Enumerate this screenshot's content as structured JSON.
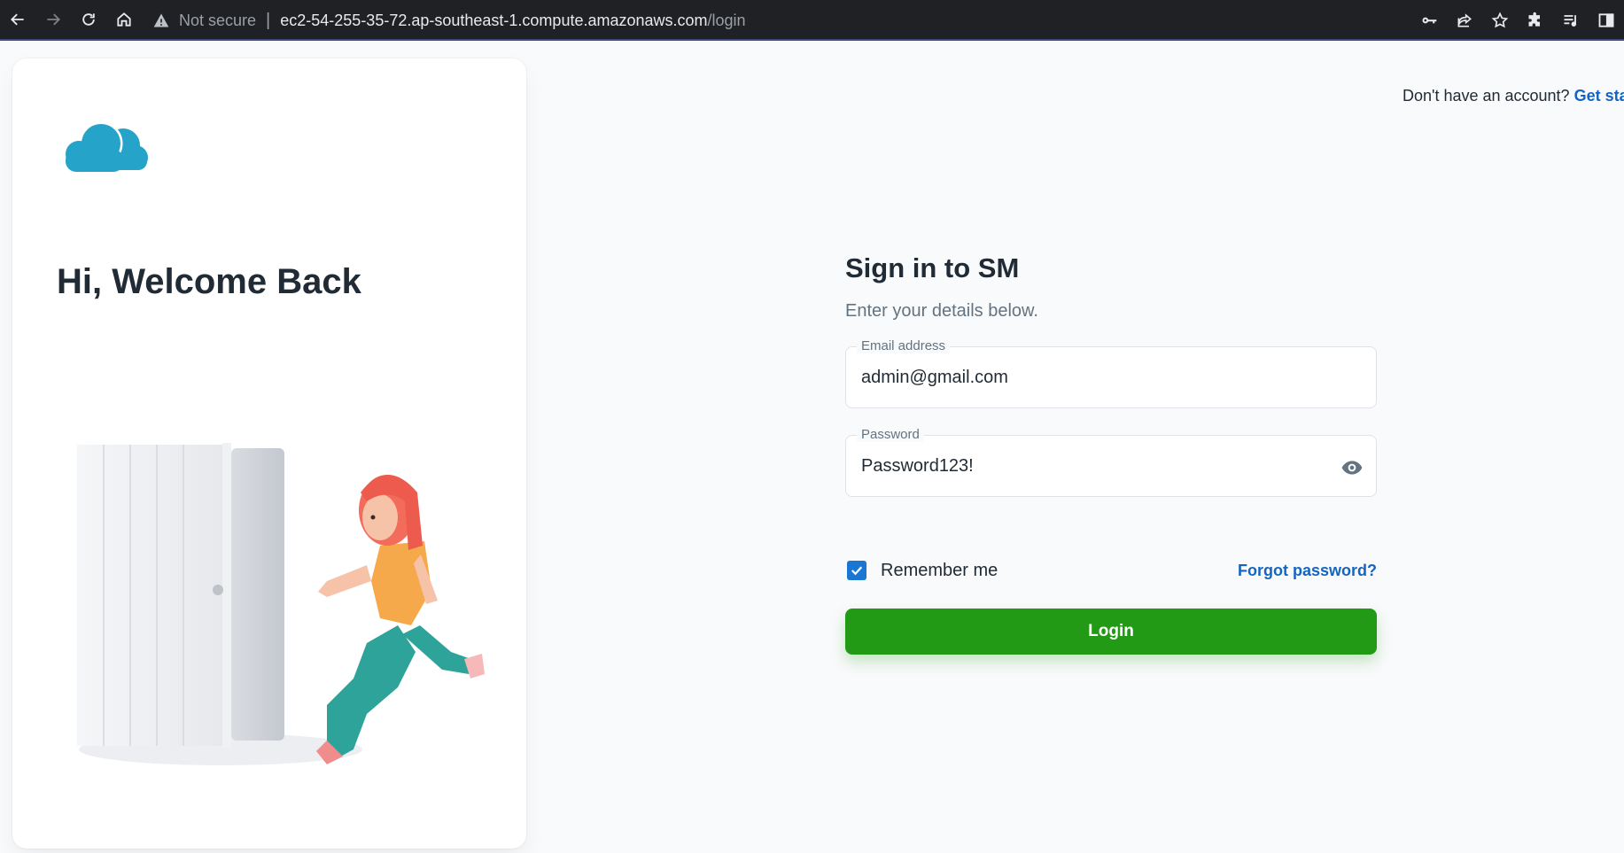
{
  "browser": {
    "security_label": "Not secure",
    "url_host": "ec2-54-255-35-72.ap-southeast-1.compute.amazonaws.com",
    "url_path": "/login",
    "icons": [
      "back-icon",
      "forward-icon",
      "reload-icon",
      "home-icon",
      "warning-icon",
      "key-icon",
      "share-icon",
      "star-icon",
      "extensions-icon",
      "reading-list-icon",
      "side-panel-icon"
    ]
  },
  "left_panel": {
    "heading": "Hi, Welcome Back",
    "logo_color": "#26a3c9"
  },
  "signup": {
    "prompt": "Don't have an account? ",
    "link": "Get started"
  },
  "form": {
    "title": "Sign in to SM",
    "subtitle": "Enter your details below.",
    "email_label": "Email address",
    "email_value": "admin@gmail.com",
    "password_label": "Password",
    "password_value": "Password123!",
    "remember_label": "Remember me",
    "remember_checked": true,
    "forgot_label": "Forgot password?",
    "login_label": "Login",
    "accent_color": "#229a16",
    "link_color": "#1565c0"
  }
}
